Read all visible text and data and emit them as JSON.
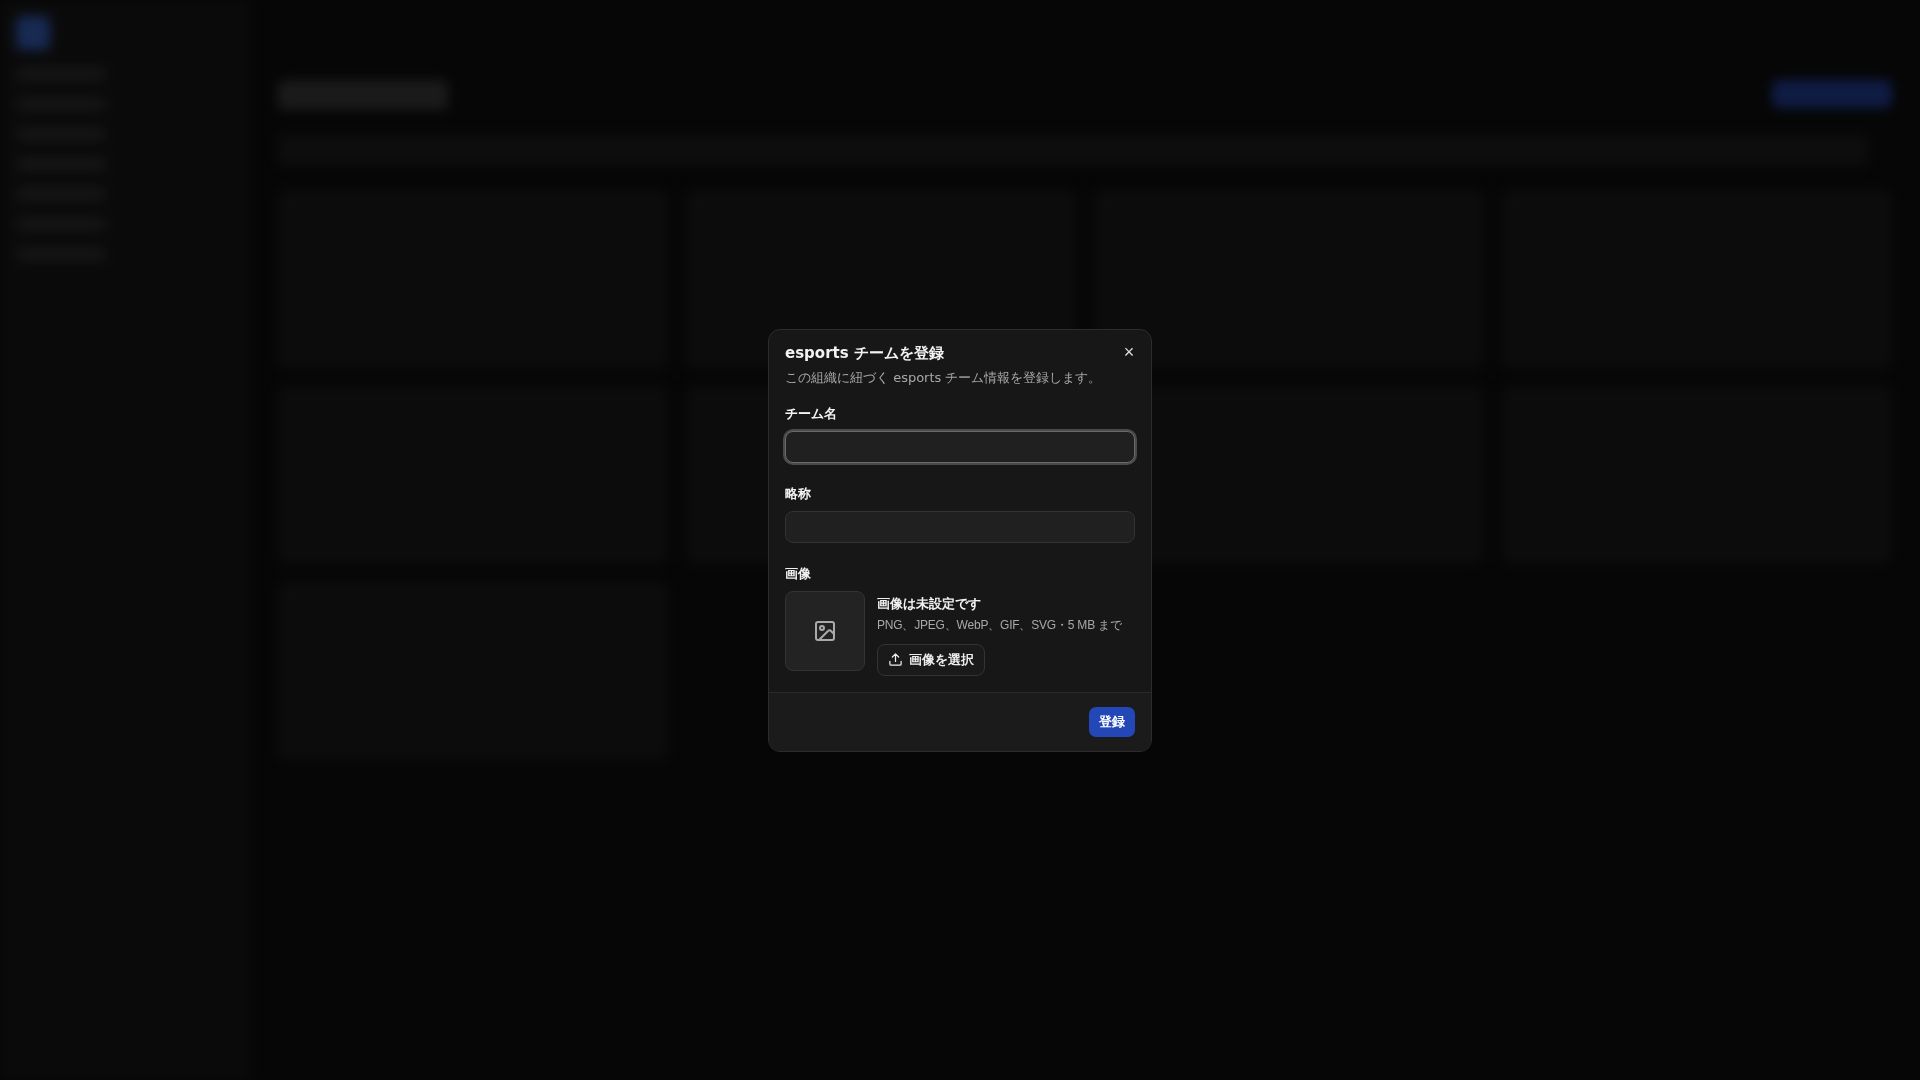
{
  "dialog": {
    "title": "esports チームを登録",
    "description": "この組織に紐づく esports チーム情報を登録します。",
    "close_icon": "×",
    "fields": [
      {
        "label": "チーム名",
        "focused": true
      },
      {
        "label": "略称",
        "focused": false
      }
    ],
    "image": {
      "label": "画像",
      "status": "画像は未設定です",
      "hint": "PNG、JPEG、WebP、GIF、SVG・5 MB まで",
      "button": "画像を選択"
    },
    "submit": "登録"
  }
}
